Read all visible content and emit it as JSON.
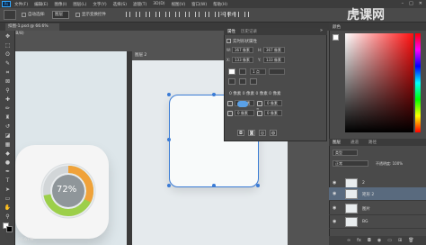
{
  "app": {
    "logo": "Ps",
    "watermark": "虎课网"
  },
  "menu": [
    "文件(F)",
    "编辑(E)",
    "图像(I)",
    "图层(L)",
    "文字(Y)",
    "选择(S)",
    "滤镜(T)",
    "3D(D)",
    "视图(V)",
    "窗口(W)",
    "帮助(H)"
  ],
  "window_controls": [
    "–",
    "□",
    "✕"
  ],
  "options": {
    "auto_select": "自动选择:",
    "select_value": "图层",
    "show_transform": "显示变换控件",
    "mode_3d": "3D 模式:"
  },
  "tabs": {
    "active": "扣图-1.psd @ 66.6%(RGB/8)"
  },
  "doc2": {
    "title": "图层 2"
  },
  "gauge": {
    "value": "72%",
    "percent": 72
  },
  "properties": {
    "tab1": "属性",
    "tab2": "历史记录",
    "close": "»",
    "heading": "实时形状属性",
    "W_label": "W:",
    "W_value": "367 像素",
    "H_label": "H:",
    "H_value": "367 像素",
    "X_label": "X:",
    "X_value": "133 像素",
    "Y_label": "Y:",
    "Y_value": "133 像素",
    "stroke_width": "1 点",
    "radius_title": "0 像素 0 像素 0 像素 0 像素",
    "r1": "40 像素",
    "r2": "0 像素",
    "r3": "0 像素",
    "r4": "0 像素",
    "link": "∞"
  },
  "color_panel": {
    "tab": "颜色"
  },
  "layers": {
    "tab1": "图层",
    "tab2": "通道",
    "tab3": "路径",
    "filter": "类型",
    "mode": "正常",
    "opacity_label": "不透明度: 100%",
    "fill_label": "填充: 100%",
    "rows": [
      {
        "name": "2"
      },
      {
        "name": "矩形 2"
      },
      {
        "name": "图片"
      },
      {
        "name": "BG"
      }
    ],
    "bottom_icons": [
      "∞",
      "fx",
      "◘",
      "◉",
      "▭",
      "⊞",
      "🗑"
    ]
  },
  "status": {
    "zoom": "66.67%"
  },
  "colors": {
    "accent": "#3a7bd5",
    "gauge_orange": "#f0a23a",
    "gauge_green": "#9ccf4a"
  }
}
